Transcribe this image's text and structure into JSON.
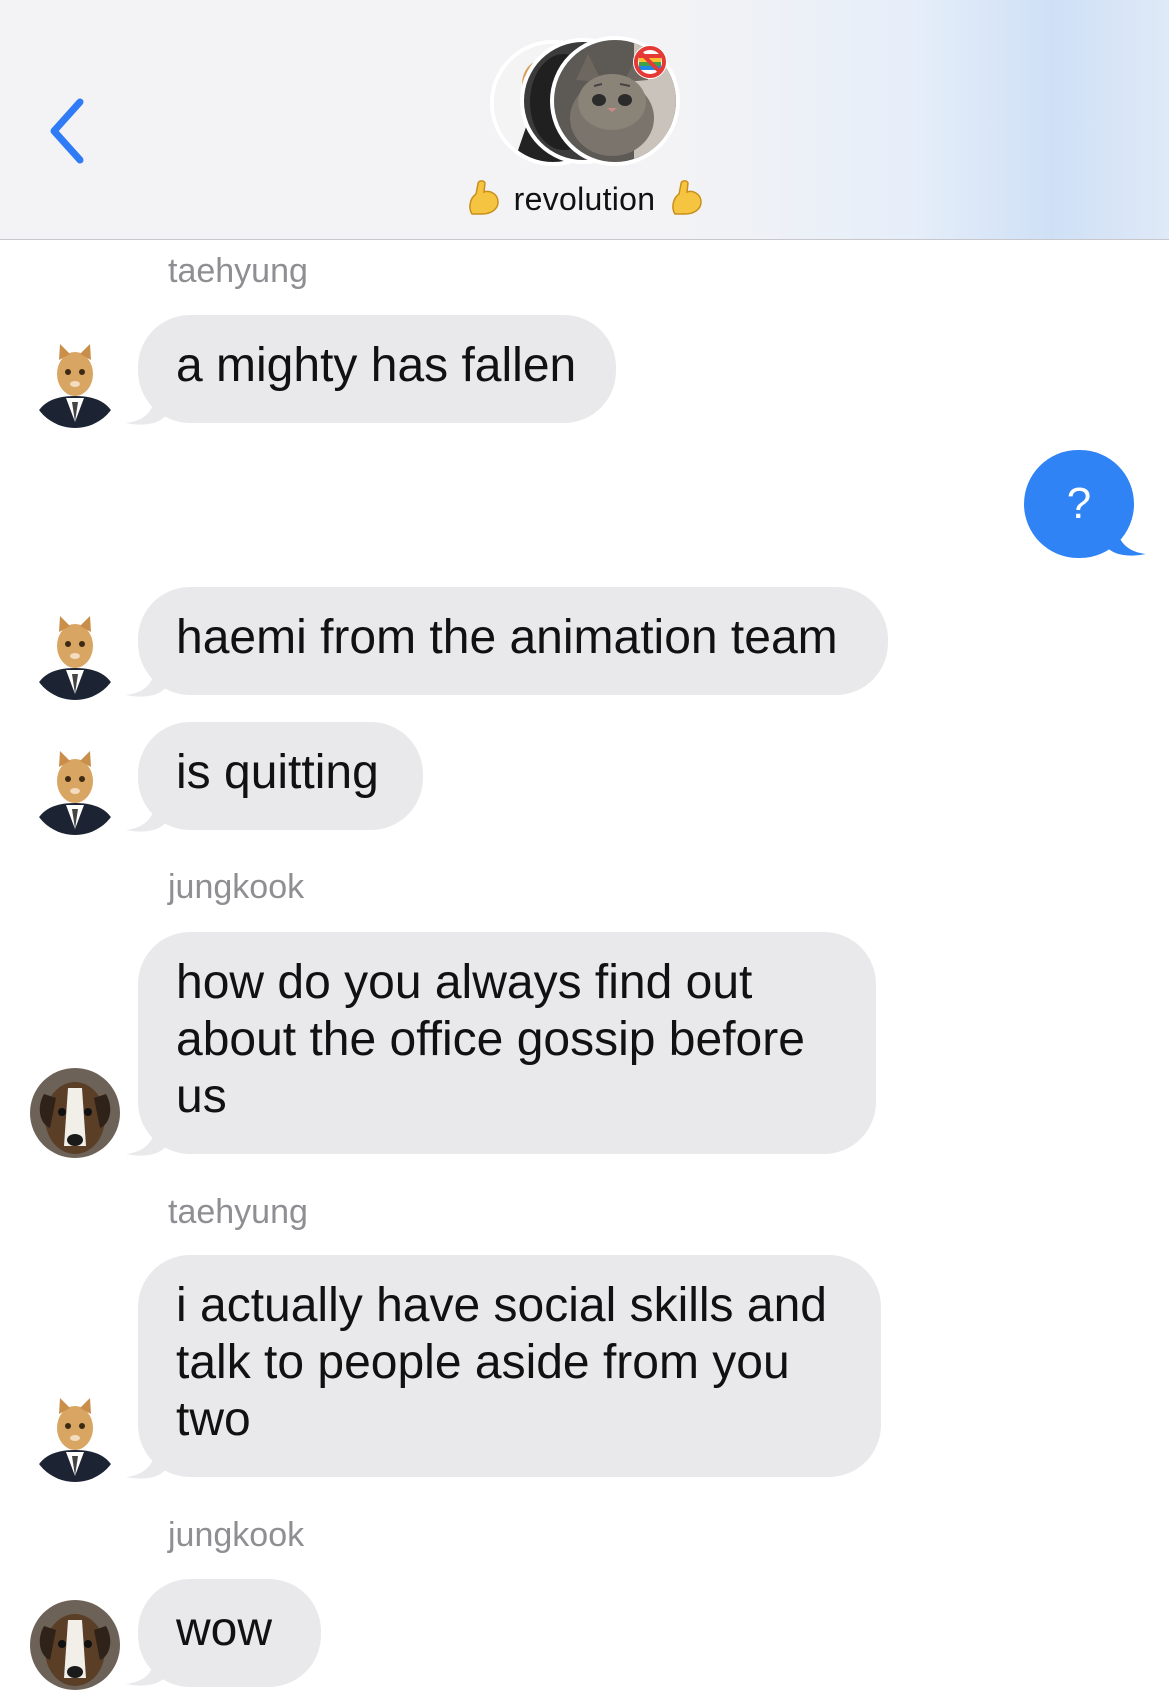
{
  "header": {
    "title": "revolution",
    "title_emoji_left": "flexed-biceps",
    "title_emoji_right": "flexed-biceps",
    "back_icon": "chevron-left-icon"
  },
  "colors": {
    "incoming_bubble": "#e9e9eb",
    "outgoing_bubble": "#2f83f5",
    "accent": "#2f7cf6",
    "sender_name": "#8e8e93"
  },
  "messages": [
    {
      "sender": "taehyung",
      "text": "a mighty has fallen",
      "avatar": "cat-in-suit-avatar"
    },
    {
      "outgoing": true,
      "text": "?"
    },
    {
      "text": "haemi from the animation team",
      "avatar": "cat-in-suit-avatar"
    },
    {
      "text": "is quitting",
      "avatar": "cat-in-suit-avatar"
    },
    {
      "sender": "jungkook",
      "text": "how do you always find out about the office gossip before us",
      "avatar": "dog-avatar"
    },
    {
      "sender": "taehyung",
      "text": "i actually have social skills and talk to people aside from you two",
      "avatar": "cat-in-suit-avatar"
    },
    {
      "sender": "jungkook",
      "text": "wow",
      "avatar": "dog-avatar"
    }
  ]
}
